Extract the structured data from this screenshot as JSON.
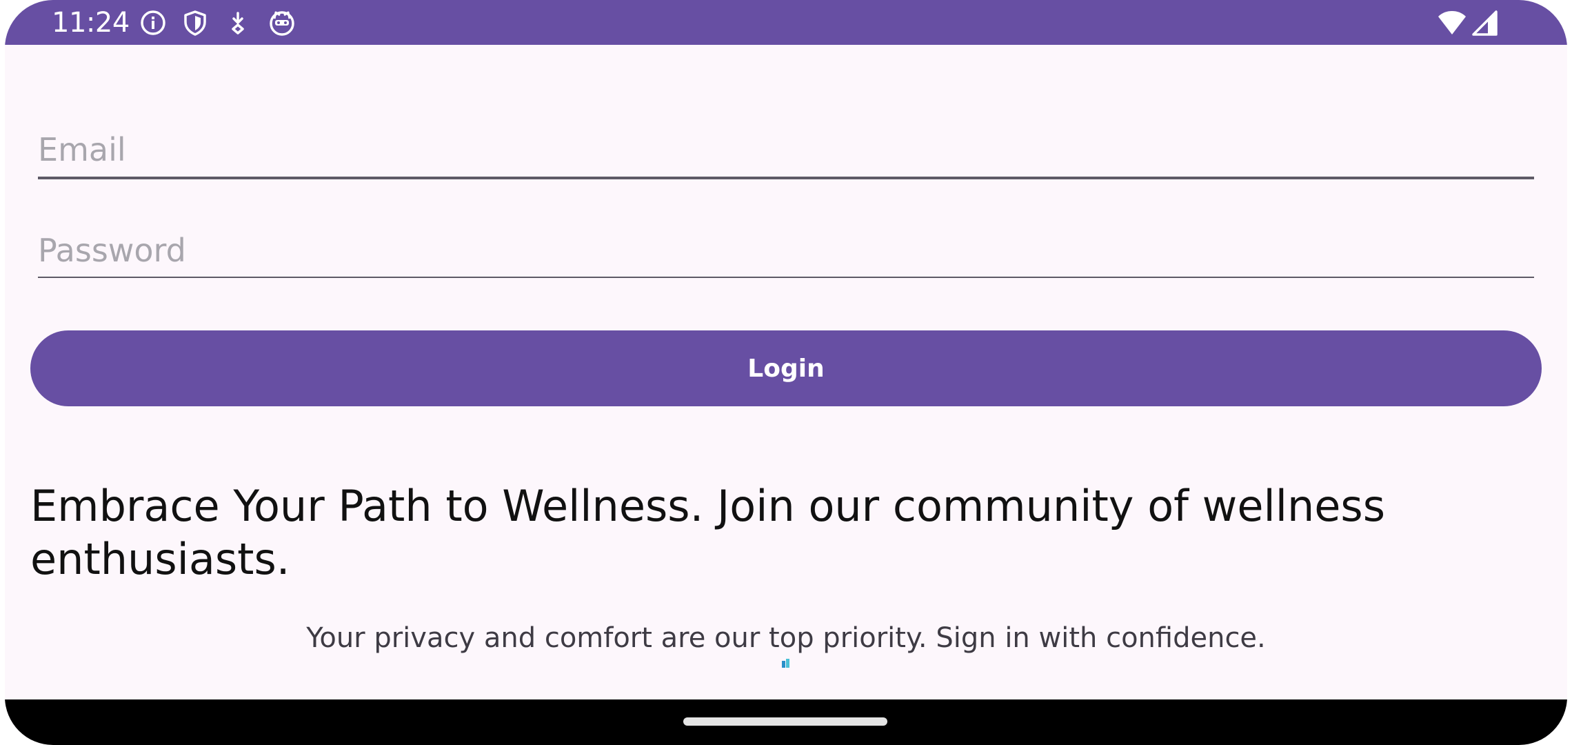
{
  "status_bar": {
    "time": "11:24",
    "background": "#674fa3",
    "left_icons": [
      "info-icon",
      "shield-icon",
      "download-icon",
      "cat-face-icon"
    ],
    "right_icons": [
      "wifi-icon",
      "cell-signal-icon"
    ]
  },
  "login_form": {
    "email": {
      "value": "",
      "placeholder": "Email"
    },
    "password": {
      "value": "",
      "placeholder": "Password"
    },
    "login_label": "Login",
    "accent_color": "#674fa3"
  },
  "content": {
    "headline": "Embrace Your Path to Wellness. Join our community of wellness enthusiasts.",
    "subtext": "Your privacy and comfort are our top priority. Sign in with confidence."
  },
  "navigation_bar": {
    "handle": "home-gesture-handle"
  }
}
